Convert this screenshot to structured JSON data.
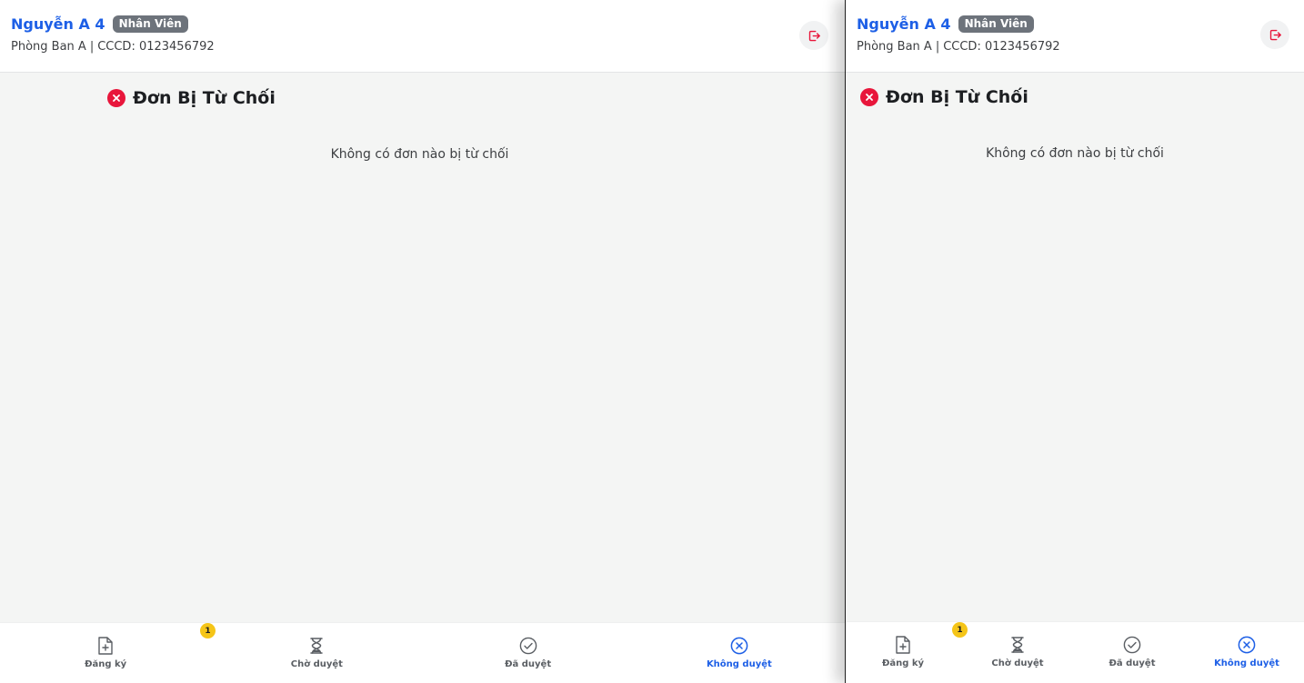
{
  "colors": {
    "brand_blue": "#1d5fe6",
    "reject_red": "#e8163b",
    "badge_yellow": "#f5c518",
    "role_badge_gray": "#6d737b"
  },
  "header": {
    "user_name": "Nguyễn A 4",
    "role": "Nhân Viên",
    "department": "Phòng Ban A",
    "separator": "|",
    "id_label": "CCCD: 0123456792",
    "logout_icon": "logout-icon"
  },
  "section": {
    "title": "Đơn Bị Từ Chối",
    "icon": "close-circle-icon",
    "empty_message": "Không có đơn nào bị từ chối"
  },
  "bottom_nav": {
    "items": [
      {
        "label": "Đăng ký",
        "icon": "file-plus-icon",
        "active": false
      },
      {
        "label": "Chờ duyệt",
        "icon": "hourglass-icon",
        "active": false,
        "badge": "1"
      },
      {
        "label": "Đã duyệt",
        "icon": "check-circle-icon",
        "active": false
      },
      {
        "label": "Không duyệt",
        "icon": "x-circle-icon",
        "active": true
      }
    ]
  }
}
